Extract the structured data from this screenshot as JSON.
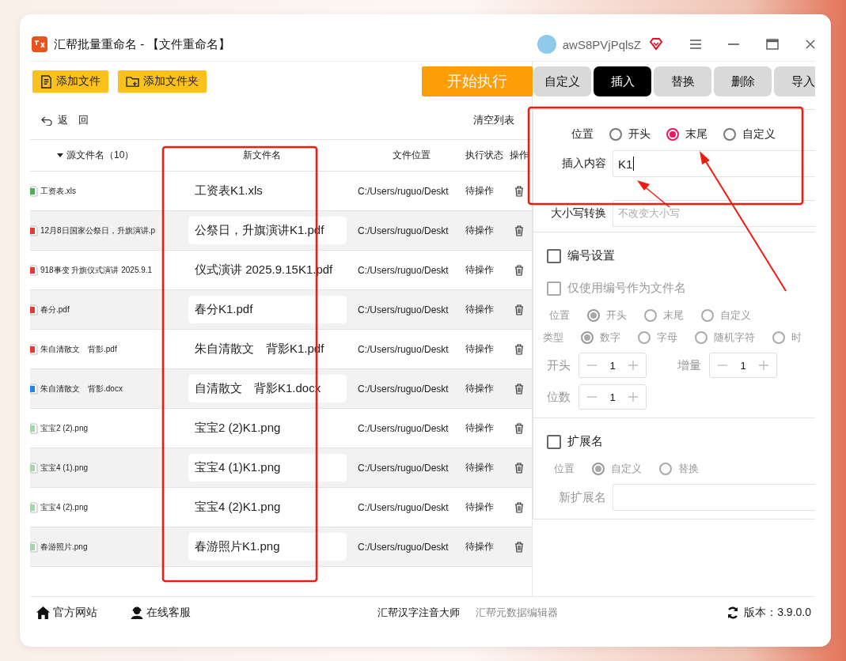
{
  "window": {
    "title": "汇帮批量重命名 - 【文件重命名】",
    "username": "awS8PVjPqlsZ"
  },
  "toolbar": {
    "add_file": "添加文件",
    "add_folder": "添加文件夹",
    "start": "开始执行"
  },
  "list_bar": {
    "back": "返　回",
    "clear": "清空列表"
  },
  "table": {
    "columns": [
      "源文件名（10）",
      "新文件名",
      "文件位置",
      "执行状态",
      "操作"
    ],
    "rows": [
      {
        "source": "工资表.xls",
        "color": "#4caf50",
        "new_name": "工资表K1.xls",
        "location": "C:/Users/ruguo/Deskt",
        "status": "待操作"
      },
      {
        "source": "12月8日国家公祭日，升旗演讲.p",
        "color": "#e53935",
        "new_name": "公祭日，升旗演讲K1.pdf",
        "location": "C:/Users/ruguo/Deskt",
        "status": "待操作"
      },
      {
        "source": "918事变 升旗仪式演讲 2025.9.1",
        "color": "#e53935",
        "new_name": "仪式演讲 2025.9.15K1.pdf",
        "location": "C:/Users/ruguo/Deskt",
        "status": "待操作"
      },
      {
        "source": "春分.pdf",
        "color": "#e53935",
        "new_name": "春分K1.pdf",
        "location": "C:/Users/ruguo/Deskt",
        "status": "待操作"
      },
      {
        "source": "朱自清散文　背影.pdf",
        "color": "#e53935",
        "new_name": "朱自清散文　背影K1.pdf",
        "location": "C:/Users/ruguo/Deskt",
        "status": "待操作"
      },
      {
        "source": "朱自清散文　背影.docx",
        "color": "#1e88e5",
        "new_name": "自清散文　背影K1.docx",
        "location": "C:/Users/ruguo/Deskt",
        "status": "待操作"
      },
      {
        "source": "宝宝2 (2).png",
        "color": "#a5d6a7",
        "new_name": "宝宝2 (2)K1.png",
        "location": "C:/Users/ruguo/Deskt",
        "status": "待操作"
      },
      {
        "source": "宝宝4 (1).png",
        "color": "#a5d6a7",
        "new_name": "宝宝4 (1)K1.png",
        "location": "C:/Users/ruguo/Deskt",
        "status": "待操作"
      },
      {
        "source": "宝宝4 (2).png",
        "color": "#a5d6a7",
        "new_name": "宝宝4 (2)K1.png",
        "location": "C:/Users/ruguo/Deskt",
        "status": "待操作"
      },
      {
        "source": "春游照片.png",
        "color": "#a5d6a7",
        "new_name": "春游照片K1.png",
        "location": "C:/Users/ruguo/Deskt",
        "status": "待操作"
      }
    ]
  },
  "tabs": [
    {
      "label": "自定义",
      "selected": false
    },
    {
      "label": "插入",
      "selected": true
    },
    {
      "label": "替换",
      "selected": false
    },
    {
      "label": "删除",
      "selected": false
    },
    {
      "label": "导入",
      "selected": false
    }
  ],
  "insert": {
    "position": {
      "label": "位置",
      "disabled": false,
      "options": [
        {
          "label": "开头",
          "selected": false
        },
        {
          "label": "末尾",
          "selected": true
        },
        {
          "label": "自定义",
          "selected": false
        }
      ]
    },
    "content": {
      "label": "插入内容",
      "value": "K1"
    },
    "case": {
      "label": "大小写转换",
      "value": "不改变大小写"
    }
  },
  "numbering": {
    "checkbox": {
      "label": "编号设置",
      "checked": false,
      "disabled": false
    },
    "only_number": {
      "label": "仅使用编号作为文件名",
      "checked": false,
      "disabled": true
    },
    "position": {
      "label": "位置",
      "disabled": true,
      "options": [
        {
          "label": "开头",
          "selected": true
        },
        {
          "label": "末尾",
          "selected": false
        },
        {
          "label": "自定义",
          "selected": false
        }
      ]
    },
    "type": {
      "label": "类型",
      "disabled": true,
      "options": [
        {
          "label": "数字",
          "selected": true
        },
        {
          "label": "字母",
          "selected": false
        },
        {
          "label": "随机字符",
          "selected": false
        },
        {
          "label": "时",
          "selected": false
        }
      ]
    },
    "steppers": [
      {
        "label": "开头",
        "value": "1"
      },
      {
        "label": "增量",
        "value": "1"
      },
      {
        "label": "位数",
        "value": "1"
      }
    ]
  },
  "extension": {
    "checkbox": {
      "label": "扩展名",
      "checked": false,
      "disabled": false
    },
    "position": {
      "label": "位置",
      "disabled": true,
      "options": [
        {
          "label": "自定义",
          "selected": true
        },
        {
          "label": "替换",
          "selected": false
        }
      ]
    },
    "new_ext": {
      "label": "新扩展名"
    }
  },
  "footer": {
    "links": [
      {
        "label": "官方网站",
        "kind": "home"
      },
      {
        "label": "在线客服",
        "kind": "support"
      }
    ],
    "products": [
      {
        "label": "汇帮汉字注音大师",
        "muted": false
      },
      {
        "label": "汇帮元数据编辑器",
        "muted": true
      }
    ],
    "version": "版本：3.9.0.0"
  }
}
